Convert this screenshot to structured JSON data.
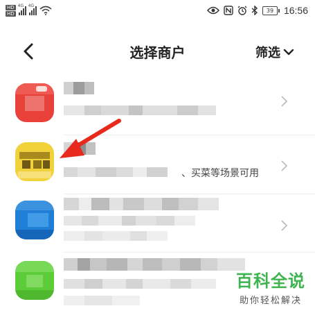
{
  "status_bar": {
    "hd_badges": [
      "HD",
      "HD"
    ],
    "network_types": [
      "4G",
      "4G"
    ],
    "battery": "39",
    "time": "16:56"
  },
  "header": {
    "title": "选择商户",
    "filter_label": "筛选"
  },
  "merchants": [
    {
      "description": ""
    },
    {
      "description": "、买菜等场景可用"
    },
    {
      "description": ""
    },
    {
      "description": ""
    }
  ],
  "watermark": {
    "brand": "百科全说",
    "slogan": "助你轻松解决"
  },
  "colors": {
    "accent_red": "#e03a2c",
    "arrow": "#e8291d",
    "watermark_green": "#3fb34f",
    "avatar_red": "#e8413a",
    "avatar_yellow": "#f2d23a",
    "avatar_blue": "#1f7ed6",
    "avatar_green": "#5ccd38"
  }
}
